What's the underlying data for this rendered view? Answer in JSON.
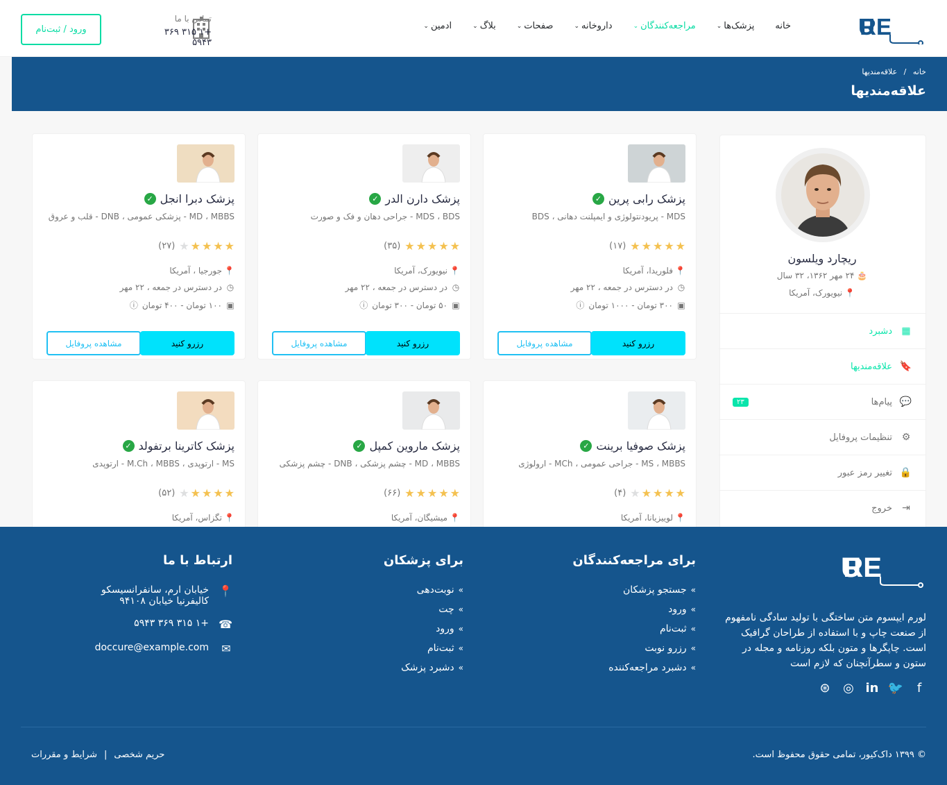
{
  "header": {
    "brand": "DOCCURE",
    "nav": [
      {
        "label": "خانه",
        "dropdown": false,
        "active": false
      },
      {
        "label": "پزشک‌ها",
        "dropdown": true,
        "active": false
      },
      {
        "label": "مراجعه‌کنندگان",
        "dropdown": true,
        "active": true
      },
      {
        "label": "داروخانه",
        "dropdown": true,
        "active": false
      },
      {
        "label": "صفحات",
        "dropdown": true,
        "active": false
      },
      {
        "label": "بلاگ",
        "dropdown": true,
        "active": false
      },
      {
        "label": "ادمین",
        "dropdown": true,
        "active": false
      }
    ],
    "contact_label": "تماس با ما",
    "contact_phone": "+۱ ۳۱۵ ۳۶۹ ۵۹۴۳",
    "login_label": "ورود / ثبت‌نام"
  },
  "breadcrumb": {
    "home": "خانه",
    "separator": "/",
    "current": "علاقه‌مندیها",
    "title": "علاقه‌مندیها"
  },
  "profile": {
    "name": "ریچارد ویلسون",
    "birth": "۲۴ مهر ۱۳۶۲، ۳۲ سال",
    "location": "نیویورک، آمریکا",
    "menu": [
      {
        "label": "دشبرد",
        "icon": "dashboard-icon",
        "active": true
      },
      {
        "label": "علاقه‌مندیها",
        "icon": "bookmark-icon",
        "active": true
      },
      {
        "label": "پیام‌ها",
        "icon": "messages-icon",
        "badge": "۲۳",
        "active": false
      },
      {
        "label": "تنظیمات پروفایل",
        "icon": "user-cog-icon",
        "active": false
      },
      {
        "label": "تغییر رمز عبور",
        "icon": "lock-icon",
        "active": false
      },
      {
        "label": "خروج",
        "icon": "sign-out-icon",
        "active": false
      }
    ]
  },
  "doctors": [
    {
      "name": "پزشک رابی پرین",
      "spec": "MDS - پریودنتولوژی و ایمپلنت دهانی ، BDS",
      "rating": 5,
      "reviews": "(۱۷)",
      "location": "فلوریدا، آمریکا",
      "available": "در دسترس در جمعه ، ۲۲ مهر",
      "price": "۳۰۰ تومان - ۱۰۰۰ تومان"
    },
    {
      "name": "پزشک دارن الدر",
      "spec": "MDS ، BDS - جراحی دهان و فک و صورت",
      "rating": 5,
      "reviews": "(۳۵)",
      "location": "نیویورک، آمریکا",
      "available": "در دسترس در جمعه ، ۲۲ مهر",
      "price": "۵۰ تومان - ۳۰۰ تومان"
    },
    {
      "name": "پزشک دبرا انجل",
      "spec": "MD ، MBBS - پزشکی عمومی ، DNB - قلب و عروق",
      "rating": 4,
      "reviews": "(۲۷)",
      "location": "جورجیا ، آمریکا",
      "available": "در دسترس در جمعه ، ۲۲ مهر",
      "price": "۱۰۰ تومان - ۴۰۰ تومان"
    },
    {
      "name": "پزشک صوفیا برینت",
      "spec": "MS ، MBBS - جراحی عمومی ، MCh - ارولوژی",
      "rating": 4,
      "reviews": "(۴)",
      "location": "لوییزیانا، آمریکا"
    },
    {
      "name": "پزشک ماروین کمپل",
      "spec": "MD ، MBBS - چشم پزشکی ، DNB - چشم پزشکی",
      "rating": 5,
      "reviews": "(۶۶)",
      "location": "میشیگان، آمریکا"
    },
    {
      "name": "پزشک کاترینا برتفولد",
      "spec": "MS - ارتوپدی ، M.Ch ، MBBS - ارتوپدی",
      "rating": 4,
      "reviews": "(۵۲)",
      "location": "تگزاس، آمریکا"
    }
  ],
  "buttons": {
    "view_profile": "مشاهده پروفایل",
    "book": "رزرو کنید"
  },
  "footer": {
    "about": "لورم ایپسوم متن ساختگی با تولید سادگی نامفهوم از صنعت چاپ و با استفاده از طراحان گرافیک است. چاپگرها و متون بلکه روزنامه و مجله در ستون و سطرآنچنان که لازم است",
    "patients_title": "برای مراجعه‌کنندگان",
    "patients_links": [
      "جستجو پزشکان",
      "ورود",
      "ثبت‌نام",
      "رزرو نوبت",
      "دشبرد مراجعه‌کننده"
    ],
    "doctors_title": "برای پزشکان",
    "doctors_links": [
      "نوبت‌دهی",
      "چت",
      "ورود",
      "ثبت‌نام",
      "دشبرد پزشک"
    ],
    "contact_title": "ارتباط با ما",
    "address_line1": "خیابان ارم، سانفرانسیسکو",
    "address_line2": "کالیفرنیا خیابان ۹۴۱۰۸",
    "phone": "+۱ ۳۱۵ ۳۶۹ ۵۹۴۳",
    "email": "doccure@example.com",
    "copyright": "© ۱۳۹۹ داک‌کیور، تمامی حقوق محفوظ است.",
    "terms": "شرایط و مقررات",
    "privacy": "حریم شخصی"
  },
  "colors": {
    "primary": "#15558d",
    "accent": "#09dca4",
    "cyan": "#00e2fc",
    "link_blue": "#20c0f3"
  }
}
